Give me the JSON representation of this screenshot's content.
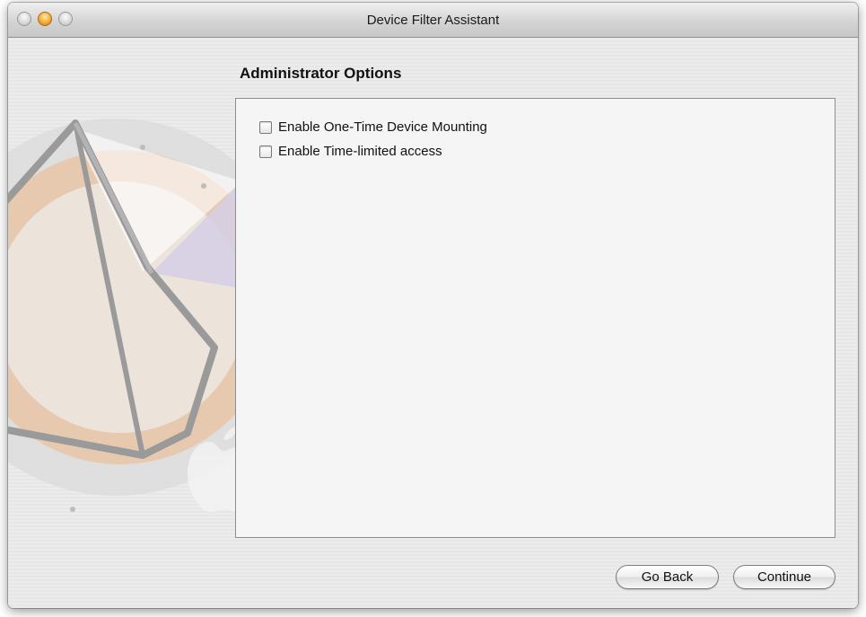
{
  "window": {
    "title": "Device Filter Assistant"
  },
  "main": {
    "heading": "Administrator Options",
    "options": [
      {
        "label": "Enable One-Time Device Mounting",
        "checked": false
      },
      {
        "label": "Enable Time-limited access",
        "checked": false
      }
    ]
  },
  "footer": {
    "back_label": "Go Back",
    "continue_label": "Continue"
  },
  "icons": {
    "background_art": "device-filter-logo",
    "apple_logo": "apple-logo"
  }
}
